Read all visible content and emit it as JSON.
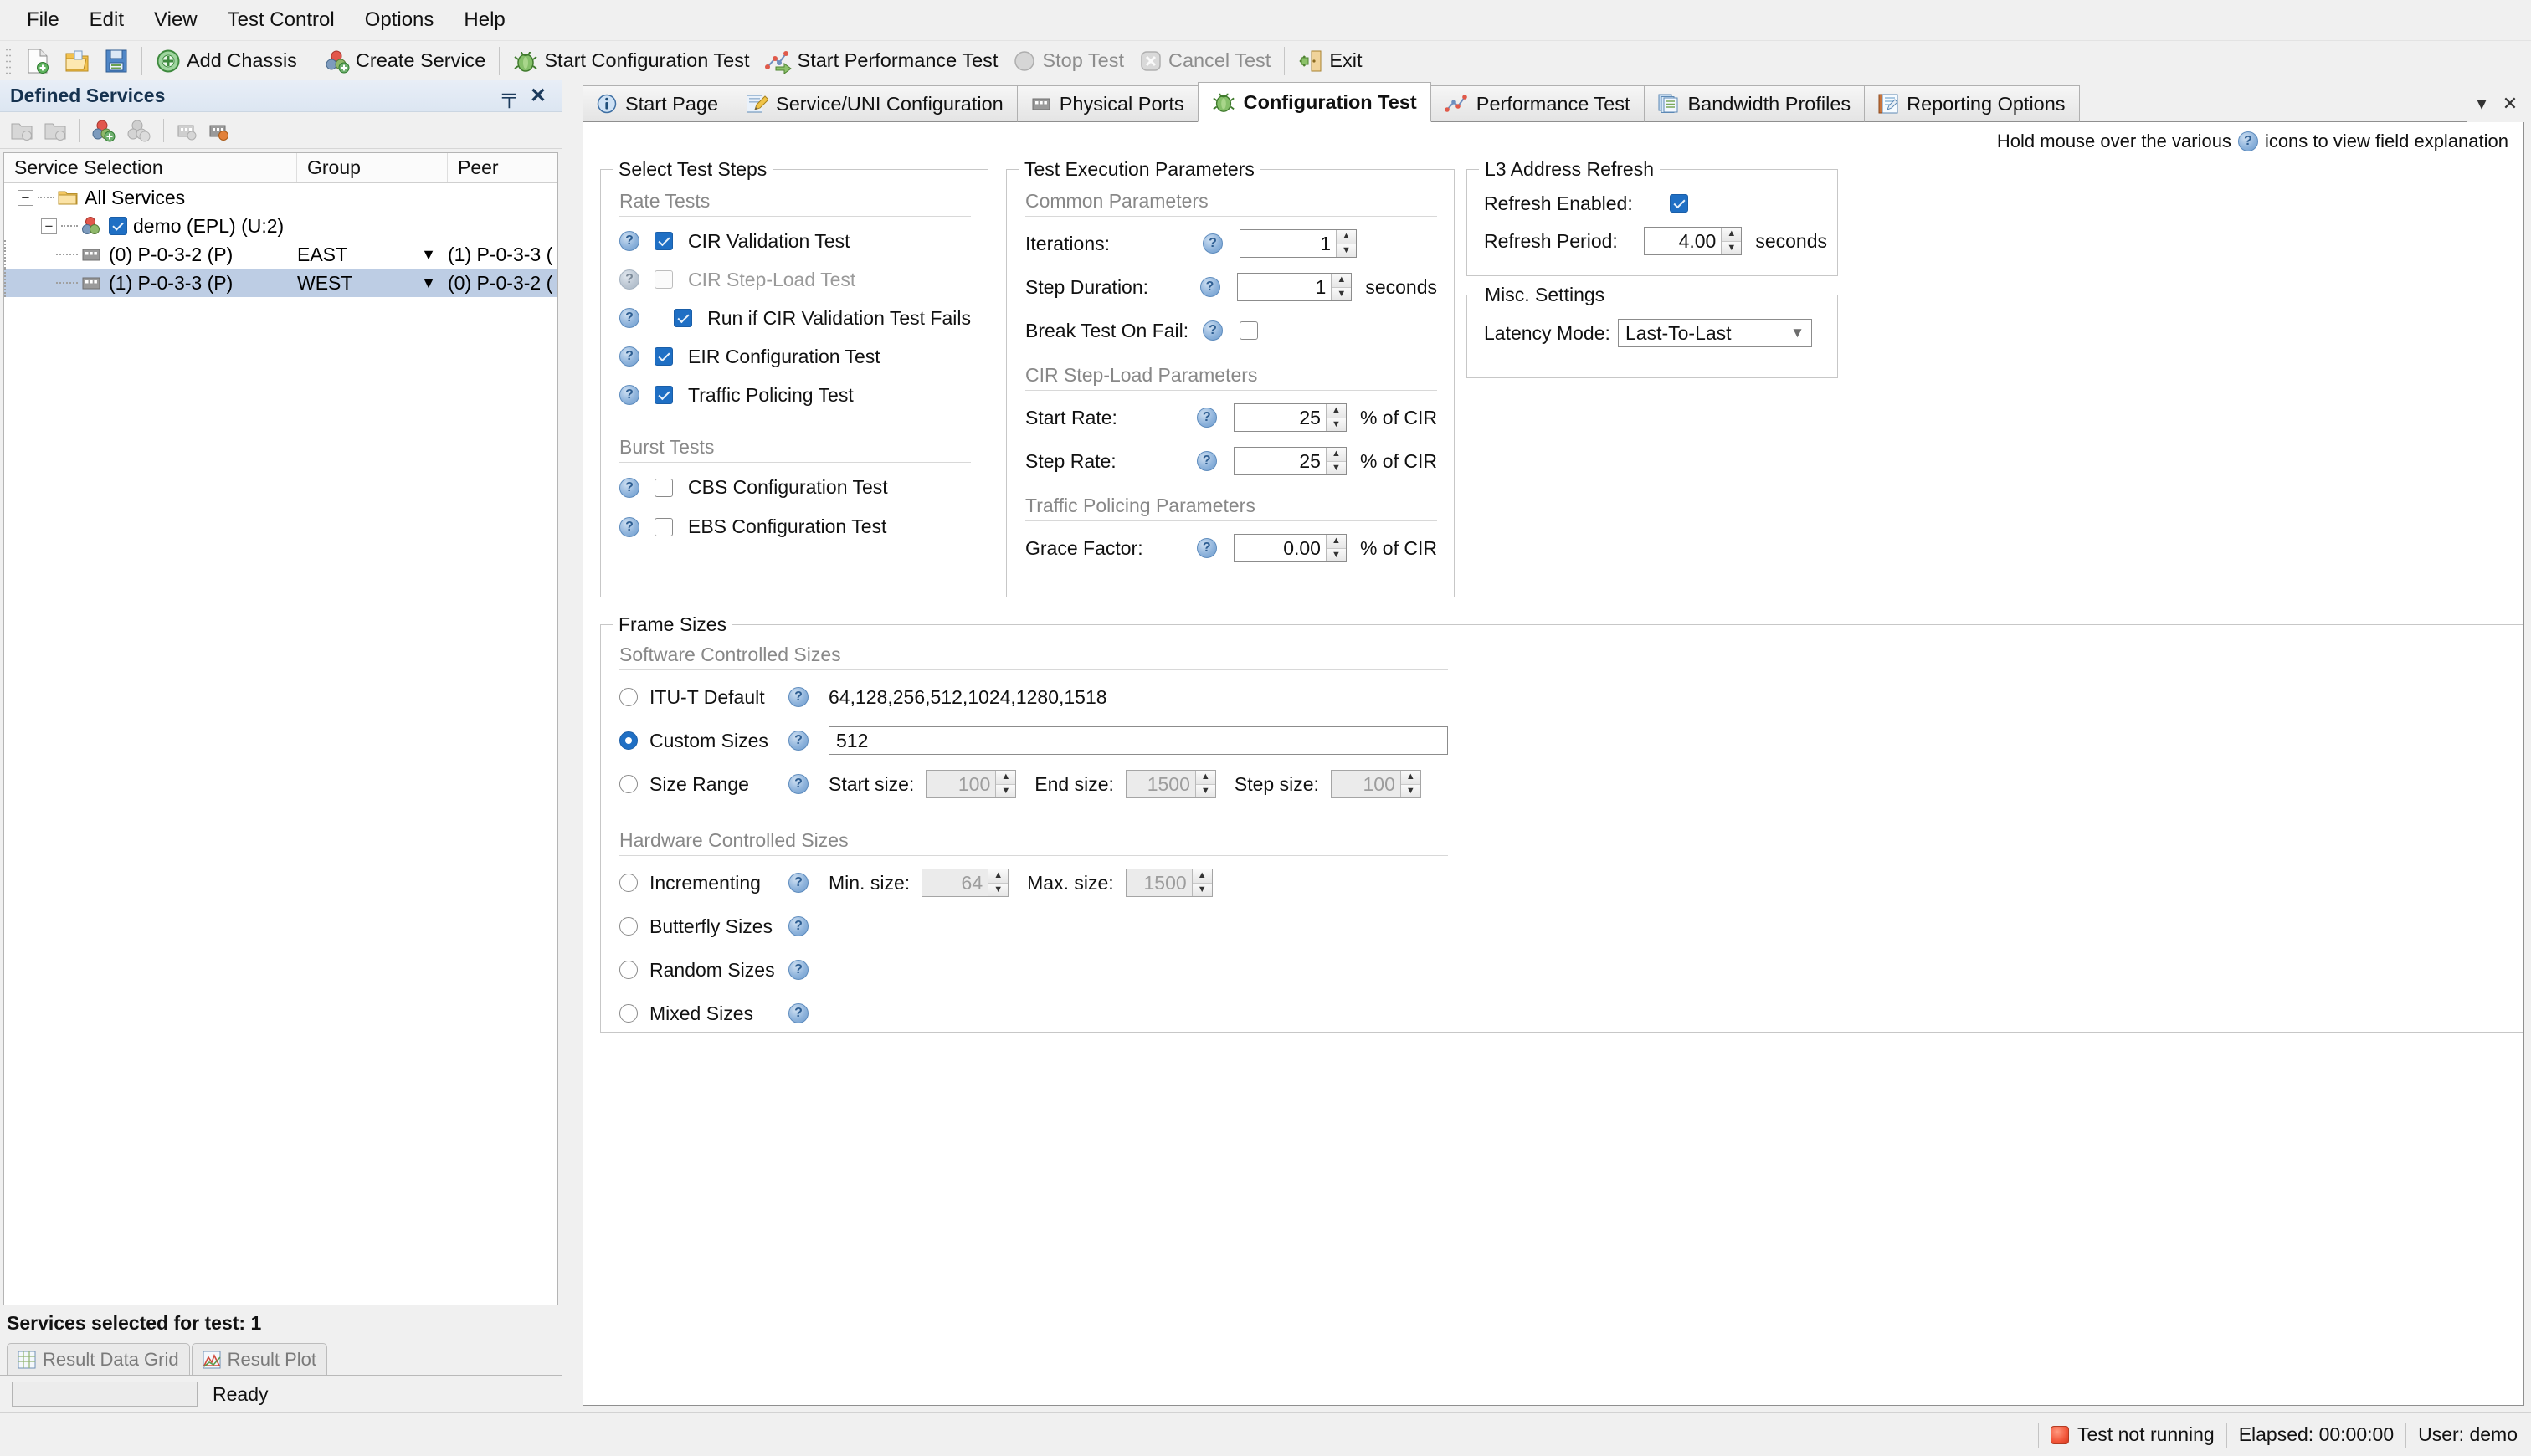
{
  "menu": {
    "items": [
      "File",
      "Edit",
      "View",
      "Test Control",
      "Options",
      "Help"
    ]
  },
  "toolbar": {
    "new_label": "",
    "open_label": "",
    "save_label": "",
    "add_chassis": "Add Chassis",
    "create_service": "Create Service",
    "start_configuration_test": "Start Configuration Test",
    "start_performance_test": "Start Performance Test",
    "stop_test": "Stop Test",
    "cancel_test": "Cancel Test",
    "exit": "Exit"
  },
  "left_panel": {
    "title": "Defined Services",
    "pin_glyph": "╤",
    "close_glyph": "✕",
    "columns": [
      "Service Selection",
      "Group",
      "Peer"
    ],
    "tree": [
      {
        "label": "All Services",
        "group": "",
        "peer": "",
        "level": 0,
        "expander": "−",
        "icon": "folder-icon",
        "checked": false,
        "selected": false
      },
      {
        "label": "demo (EPL) (U:2)",
        "group": "",
        "peer": "",
        "level": 1,
        "expander": "−",
        "icon": "service-icon",
        "checked": true,
        "selected": false
      },
      {
        "label": "(0) P-0-3-2 (P)",
        "group": "EAST",
        "peer": "(1) P-0-3-3 (",
        "level": 2,
        "expander": "",
        "icon": "port-icon",
        "checked": false,
        "selected": false
      },
      {
        "label": "(1) P-0-3-3 (P)",
        "group": "WEST",
        "peer": "(0) P-0-3-2 (",
        "level": 2,
        "expander": "",
        "icon": "port-icon",
        "checked": false,
        "selected": true
      }
    ],
    "selected_status": "Services selected for test:  1",
    "result_tabs": [
      "Result Data Grid",
      "Result Plot"
    ],
    "ready_text": "Ready"
  },
  "tabs": [
    {
      "label": "Start Page",
      "icon": "info-icon",
      "active": false
    },
    {
      "label": "Service/UNI Configuration",
      "icon": "pencil-edit-icon",
      "active": false
    },
    {
      "label": "Physical Ports",
      "icon": "port-icon",
      "active": false
    },
    {
      "label": "Configuration Test",
      "icon": "bug-icon",
      "active": true
    },
    {
      "label": "Performance Test",
      "icon": "scatter-plot-icon",
      "active": false
    },
    {
      "label": "Bandwidth Profiles",
      "icon": "documents-icon",
      "active": false
    },
    {
      "label": "Reporting Options",
      "icon": "notebook-icon",
      "active": false
    }
  ],
  "tab_controls": {
    "dropdown_glyph": "▾",
    "close_glyph": "✕"
  },
  "hint": {
    "before": "Hold mouse over the various",
    "after": "icons to view field explanation"
  },
  "select_test_steps": {
    "title": "Select Test Steps",
    "rate_tests_header": "Rate Tests",
    "rate_tests": [
      {
        "label": "CIR Validation Test",
        "checked": true,
        "disabled": false,
        "indented": false
      },
      {
        "label": "CIR Step-Load Test",
        "checked": false,
        "disabled": true,
        "indented": false
      },
      {
        "label": "Run if CIR Validation Test Fails",
        "checked": true,
        "disabled": false,
        "indented": true
      },
      {
        "label": "EIR Configuration Test",
        "checked": true,
        "disabled": false,
        "indented": false
      },
      {
        "label": "Traffic Policing Test",
        "checked": true,
        "disabled": false,
        "indented": false
      }
    ],
    "burst_tests_header": "Burst Tests",
    "burst_tests": [
      {
        "label": "CBS Configuration Test",
        "checked": false,
        "disabled": false,
        "indented": false
      },
      {
        "label": "EBS Configuration Test",
        "checked": false,
        "disabled": false,
        "indented": false
      }
    ]
  },
  "test_execution": {
    "title": "Test Execution Parameters",
    "common_header": "Common Parameters",
    "iterations_label": "Iterations:",
    "iterations_value": "1",
    "step_duration_label": "Step Duration:",
    "step_duration_value": "1",
    "step_duration_unit": "seconds",
    "break_on_fail_label": "Break Test On Fail:",
    "break_on_fail_checked": false,
    "cir_stepload_header": "CIR Step-Load Parameters",
    "start_rate_label": "Start Rate:",
    "start_rate_value": "25",
    "start_rate_unit": "% of CIR",
    "step_rate_label": "Step Rate:",
    "step_rate_value": "25",
    "step_rate_unit": "% of CIR",
    "policing_header": "Traffic Policing Parameters",
    "grace_factor_label": "Grace Factor:",
    "grace_factor_value": "0.00",
    "grace_factor_unit": "% of CIR"
  },
  "l3_refresh": {
    "title": "L3 Address Refresh",
    "refresh_enabled_label": "Refresh Enabled:",
    "refresh_enabled_checked": true,
    "refresh_period_label": "Refresh Period:",
    "refresh_period_value": "4.00",
    "refresh_period_unit": "seconds"
  },
  "misc_settings": {
    "title": "Misc. Settings",
    "latency_mode_label": "Latency Mode:",
    "latency_mode_value": "Last-To-Last"
  },
  "frame_sizes": {
    "title": "Frame Sizes",
    "software_header": "Software Controlled Sizes",
    "itu_label": "ITU-T Default",
    "itu_selected": false,
    "itu_values": "64,128,256,512,1024,1280,1518",
    "custom_label": "Custom Sizes",
    "custom_selected": true,
    "custom_value": "512",
    "size_range_label": "Size Range",
    "size_range_selected": false,
    "start_size_label": "Start size:",
    "start_size_value": "100",
    "end_size_label": "End size:",
    "end_size_value": "1500",
    "step_size_label": "Step size:",
    "step_size_value": "100",
    "hardware_header": "Hardware Controlled Sizes",
    "incrementing_label": "Incrementing",
    "incrementing_selected": false,
    "min_size_label": "Min. size:",
    "min_size_value": "64",
    "max_size_label": "Max. size:",
    "max_size_value": "1500",
    "butterfly_label": "Butterfly Sizes",
    "butterfly_selected": false,
    "random_label": "Random Sizes",
    "random_selected": false,
    "mixed_label": "Mixed Sizes",
    "mixed_selected": false
  },
  "statusbar": {
    "test_state": "Test not running",
    "elapsed": "Elapsed: 00:00:00",
    "user": "User: demo"
  },
  "colors": {
    "accent": "#1f6fc4",
    "tab_active_bg": "#ffffff",
    "selection": "#bdcde4",
    "led_red": "#f2563a"
  }
}
